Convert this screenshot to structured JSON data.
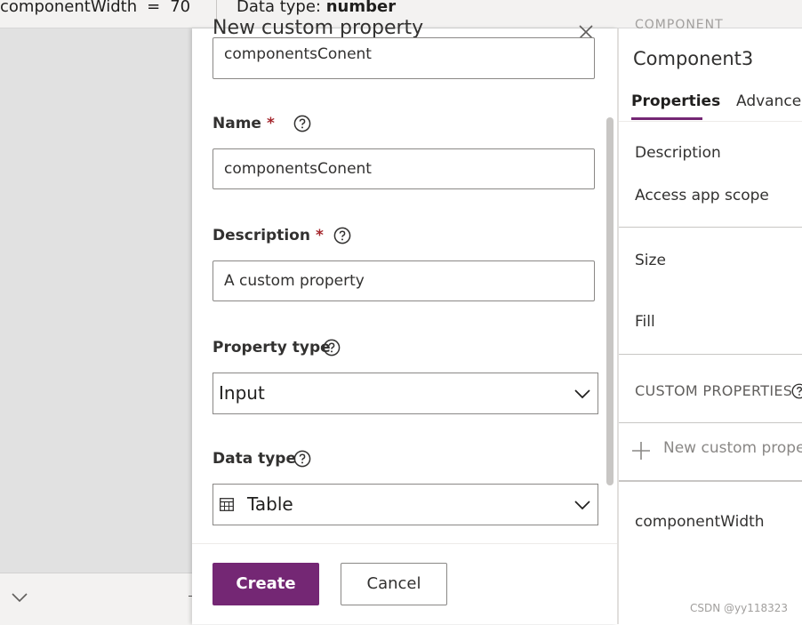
{
  "topbar": {
    "property_name": "componentWidth",
    "equals": "=",
    "property_value": "70",
    "data_type_label": "Data type:",
    "data_type_value": "number"
  },
  "dialog": {
    "title": "New custom property",
    "display_name_value": "componentsConent",
    "name_label": "Name",
    "name_value": "componentsConent",
    "description_label": "Description",
    "description_value": "A custom property",
    "required_mark": "*",
    "property_type_label": "Property type",
    "property_type_value": "Input",
    "data_type_label": "Data type",
    "data_type_value": "Table",
    "create_label": "Create",
    "cancel_label": "Cancel"
  },
  "right_panel": {
    "header_cut": "COMPONENT",
    "component_name": "Component3",
    "tabs": [
      {
        "label": "Properties",
        "active": true
      },
      {
        "label": "Advanced",
        "active": false
      }
    ],
    "rows": [
      "Description",
      "Access app scope",
      "Size",
      "Fill"
    ],
    "custom_properties_header": "CUSTOM PROPERTIES",
    "new_custom_property": "New custom proper",
    "custom_property_item": "componentWidth"
  },
  "watermark": "CSDN @yy118323",
  "colors": {
    "accent": "#742774",
    "required": "#a4262c",
    "canvas": "#e1e1e1"
  },
  "icons": [
    "help-icon",
    "close-icon",
    "chevron-down-icon",
    "table-icon",
    "plus-icon"
  ]
}
